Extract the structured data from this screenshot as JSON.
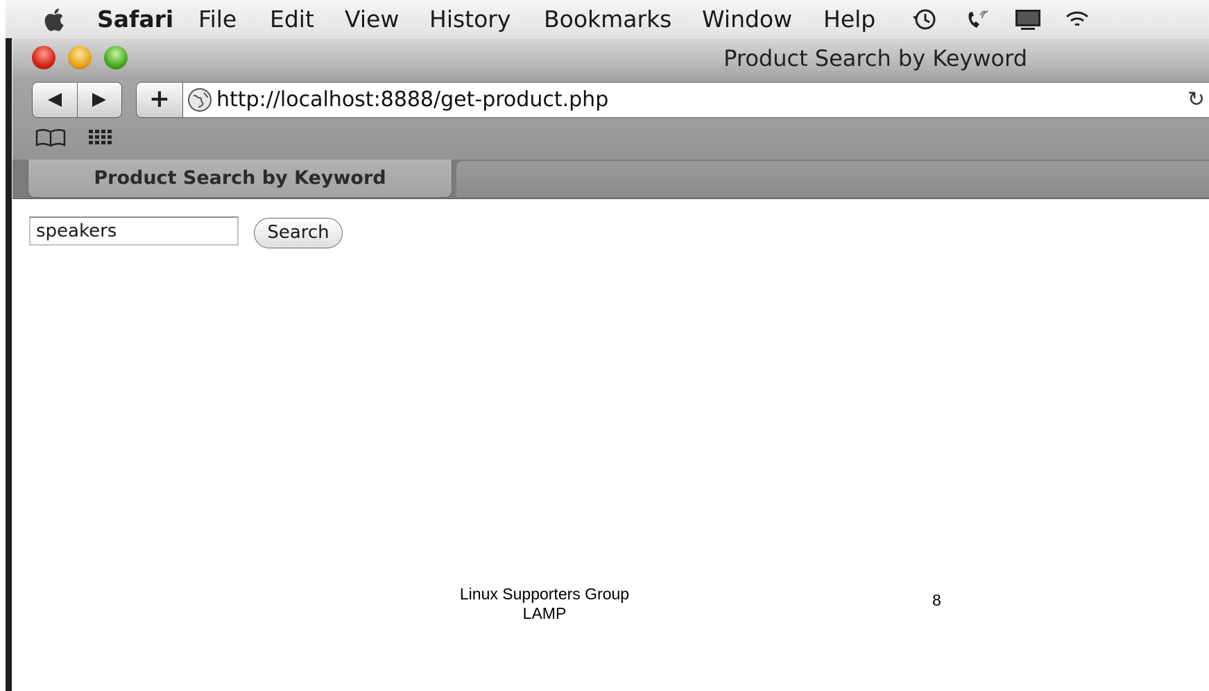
{
  "menubar": {
    "app_name": "Safari",
    "items": [
      "File",
      "Edit",
      "View",
      "History",
      "Bookmarks",
      "Window",
      "Help"
    ],
    "status_icons": [
      "time-machine-icon",
      "phone-icon",
      "display-icon",
      "wifi-icon"
    ]
  },
  "window": {
    "title": "Product Search by Keyword"
  },
  "toolbar": {
    "add_label": "+",
    "url": "http://localhost:8888/get-product.php",
    "reload_glyph": "↻"
  },
  "tabs": [
    {
      "label": "Product Search by Keyword",
      "active": true
    }
  ],
  "page": {
    "search_value": "speakers",
    "search_button": "Search"
  },
  "footer": {
    "line1": "Linux Supporters Group",
    "line2": "LAMP",
    "page_number": "8"
  }
}
